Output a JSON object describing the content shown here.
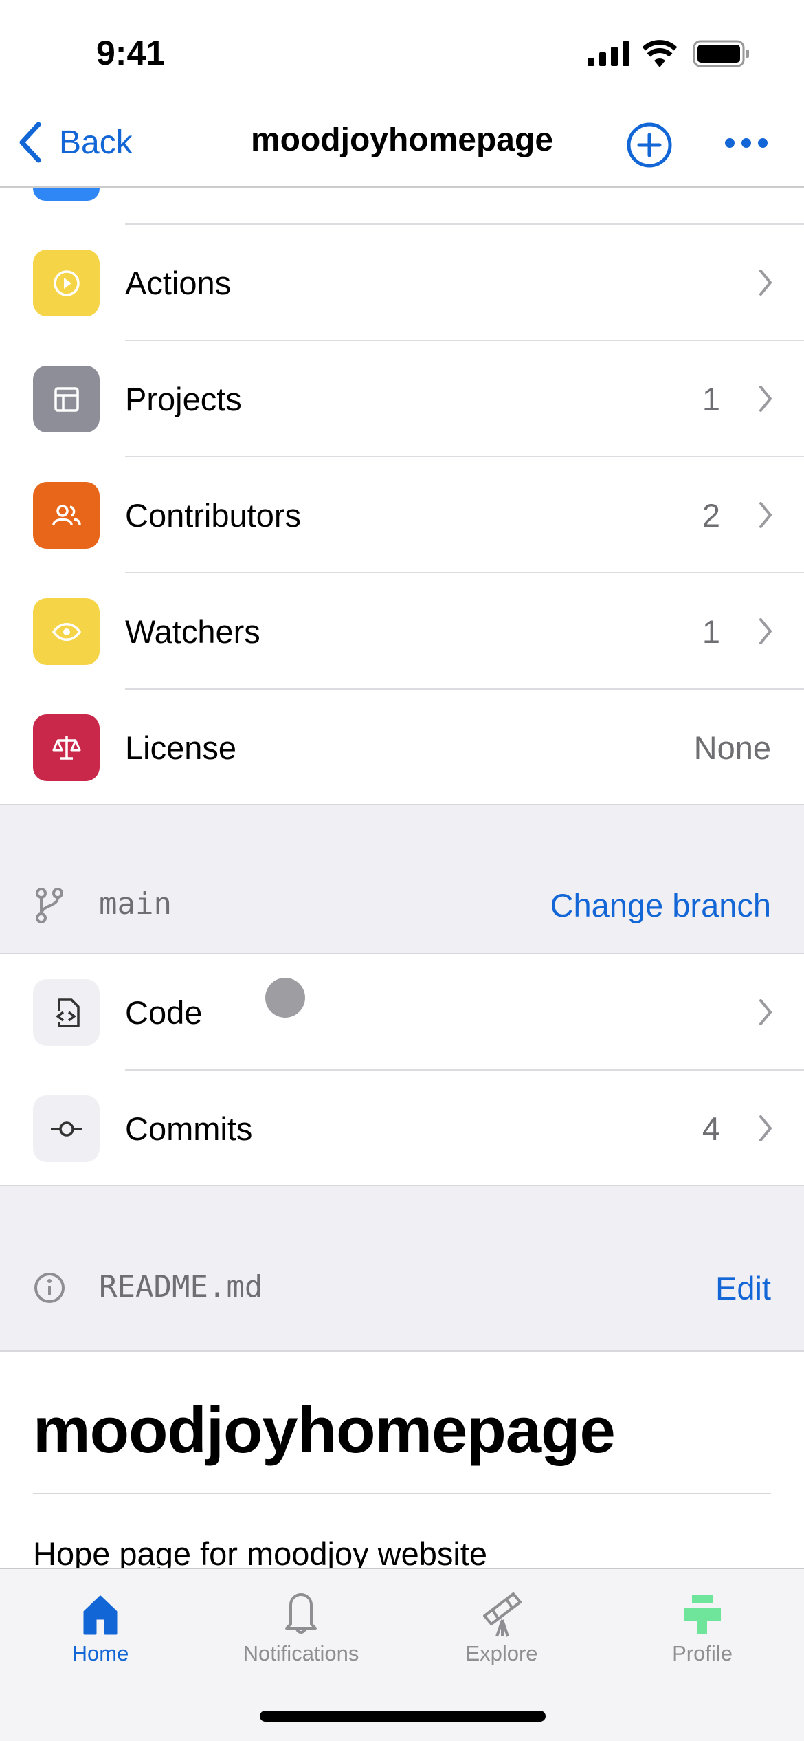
{
  "status_bar": {
    "time": "9:41"
  },
  "nav": {
    "back_label": "Back",
    "title": "moodjoyhomepage"
  },
  "repo_items": [
    {
      "label": "Actions",
      "value": "",
      "icon": "play-circle-icon",
      "color": "#f5d547"
    },
    {
      "label": "Projects",
      "value": "1",
      "icon": "table-icon",
      "color": "#8e8e99"
    },
    {
      "label": "Contributors",
      "value": "2",
      "icon": "people-icon",
      "color": "#e8661a"
    },
    {
      "label": "Watchers",
      "value": "1",
      "icon": "eye-icon",
      "color": "#f5d547"
    },
    {
      "label": "License",
      "value": "None",
      "icon": "law-icon",
      "color": "#c9284a"
    }
  ],
  "branch": {
    "name": "main",
    "action": "Change branch"
  },
  "code_items": [
    {
      "label": "Code",
      "value": ""
    },
    {
      "label": "Commits",
      "value": "4"
    }
  ],
  "readme": {
    "filename": "README.md",
    "action": "Edit",
    "heading": "moodjoyhomepage",
    "body": "Hope page for moodjoy website"
  },
  "tabs": [
    {
      "label": "Home",
      "active": true
    },
    {
      "label": "Notifications",
      "active": false
    },
    {
      "label": "Explore",
      "active": false
    },
    {
      "label": "Profile",
      "active": false
    }
  ],
  "colors": {
    "accent": "#1366d6",
    "group_bg": "#efeff4",
    "profile_icon": "#6fe59b"
  }
}
